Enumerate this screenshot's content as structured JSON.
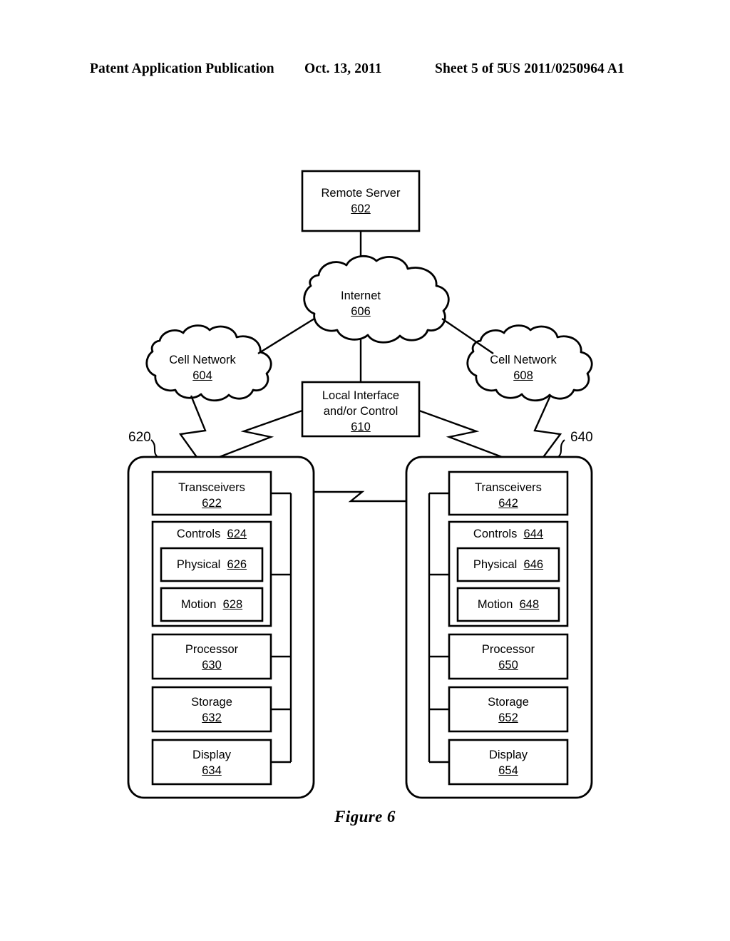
{
  "header": {
    "publication": "Patent Application Publication",
    "date": "Oct. 13, 2011",
    "sheet": "Sheet 5 of 5",
    "document_number": "US 2011/0250964 A1"
  },
  "figure": {
    "caption": "Figure 6"
  },
  "diagram": {
    "remote_server": {
      "label": "Remote Server",
      "ref": "602"
    },
    "internet": {
      "label": "Internet",
      "ref": "606"
    },
    "cell_network_left": {
      "label": "Cell Network",
      "ref": "604"
    },
    "cell_network_right": {
      "label": "Cell Network",
      "ref": "608"
    },
    "local_interface": {
      "label_line1": "Local Interface",
      "label_line2": "and/or Control",
      "ref": "610"
    },
    "device_left": {
      "ref": "620",
      "components": [
        {
          "label": "Transceivers",
          "ref": "622",
          "layout": "stacked"
        },
        {
          "label": "Controls",
          "ref": "624",
          "layout": "inline"
        },
        {
          "label": "Physical",
          "ref": "626",
          "layout": "inline"
        },
        {
          "label": "Motion",
          "ref": "628",
          "layout": "inline"
        },
        {
          "label": "Processor",
          "ref": "630",
          "layout": "stacked"
        },
        {
          "label": "Storage",
          "ref": "632",
          "layout": "stacked"
        },
        {
          "label": "Display",
          "ref": "634",
          "layout": "stacked"
        }
      ]
    },
    "device_right": {
      "ref": "640",
      "components": [
        {
          "label": "Transceivers",
          "ref": "642",
          "layout": "stacked"
        },
        {
          "label": "Controls",
          "ref": "644",
          "layout": "inline"
        },
        {
          "label": "Physical",
          "ref": "646",
          "layout": "inline"
        },
        {
          "label": "Motion",
          "ref": "648",
          "layout": "inline"
        },
        {
          "label": "Processor",
          "ref": "650",
          "layout": "stacked"
        },
        {
          "label": "Storage",
          "ref": "652",
          "layout": "stacked"
        },
        {
          "label": "Display",
          "ref": "654",
          "layout": "stacked"
        }
      ]
    }
  },
  "colors": {
    "ink": "#000000",
    "paper": "#ffffff"
  }
}
